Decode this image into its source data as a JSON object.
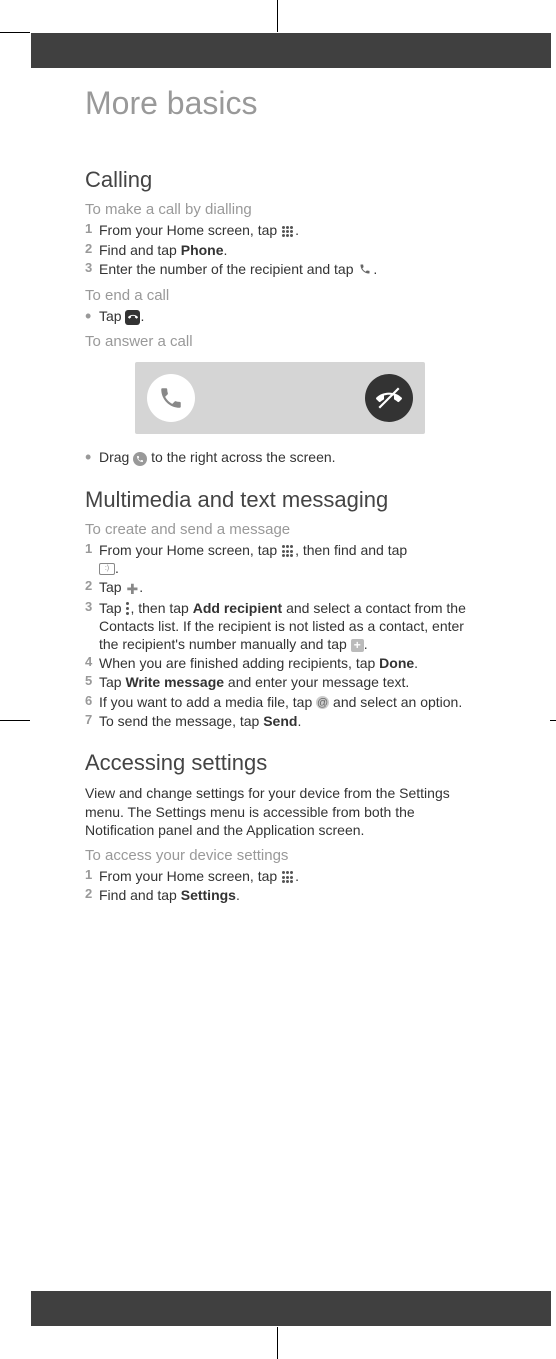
{
  "page_title": "More basics",
  "sections": {
    "calling": {
      "heading": "Calling",
      "dial": {
        "sub": "To make a call by dialling",
        "s1a": "From your Home screen, tap ",
        "s1b": ".",
        "s2a": "Find and tap ",
        "s2b": "Phone",
        "s2c": ".",
        "s3a": "Enter the number of the recipient and tap ",
        "s3b": "."
      },
      "end": {
        "sub": "To end a call",
        "s1a": "Tap ",
        "s1b": "."
      },
      "answer": {
        "sub": "To answer a call",
        "s1a": "Drag ",
        "s1b": " to the right across the screen."
      }
    },
    "messaging": {
      "heading": "Multimedia and text messaging",
      "create": {
        "sub": "To create and send a message",
        "s1a": "From your Home screen, tap ",
        "s1b": ", then find and tap ",
        "s1c": ".",
        "s2a": "Tap ",
        "s2b": ".",
        "s3a": "Tap ",
        "s3b": ", then tap ",
        "s3c": "Add recipient",
        "s3d": " and select a contact from the Contacts list. If the recipient is not listed as a contact, enter the recipient's number manually and tap ",
        "s3e": ".",
        "s4a": "When you are finished adding recipients, tap ",
        "s4b": "Done",
        "s4c": ".",
        "s5a": "Tap ",
        "s5b": "Write message",
        "s5c": " and enter your message text.",
        "s6a": "If you want to add a media file, tap ",
        "s6b": " and select an option.",
        "s7a": "To send the message, tap ",
        "s7b": "Send",
        "s7c": "."
      }
    },
    "settings": {
      "heading": "Accessing settings",
      "intro": "View and change settings for your device from the Settings menu. The Settings menu is accessible from both the Notification panel and the Application screen.",
      "access": {
        "sub": "To access your device settings",
        "s1a": "From your Home screen, tap ",
        "s1b": ".",
        "s2a": "Find and tap ",
        "s2b": "Settings",
        "s2c": "."
      }
    }
  }
}
